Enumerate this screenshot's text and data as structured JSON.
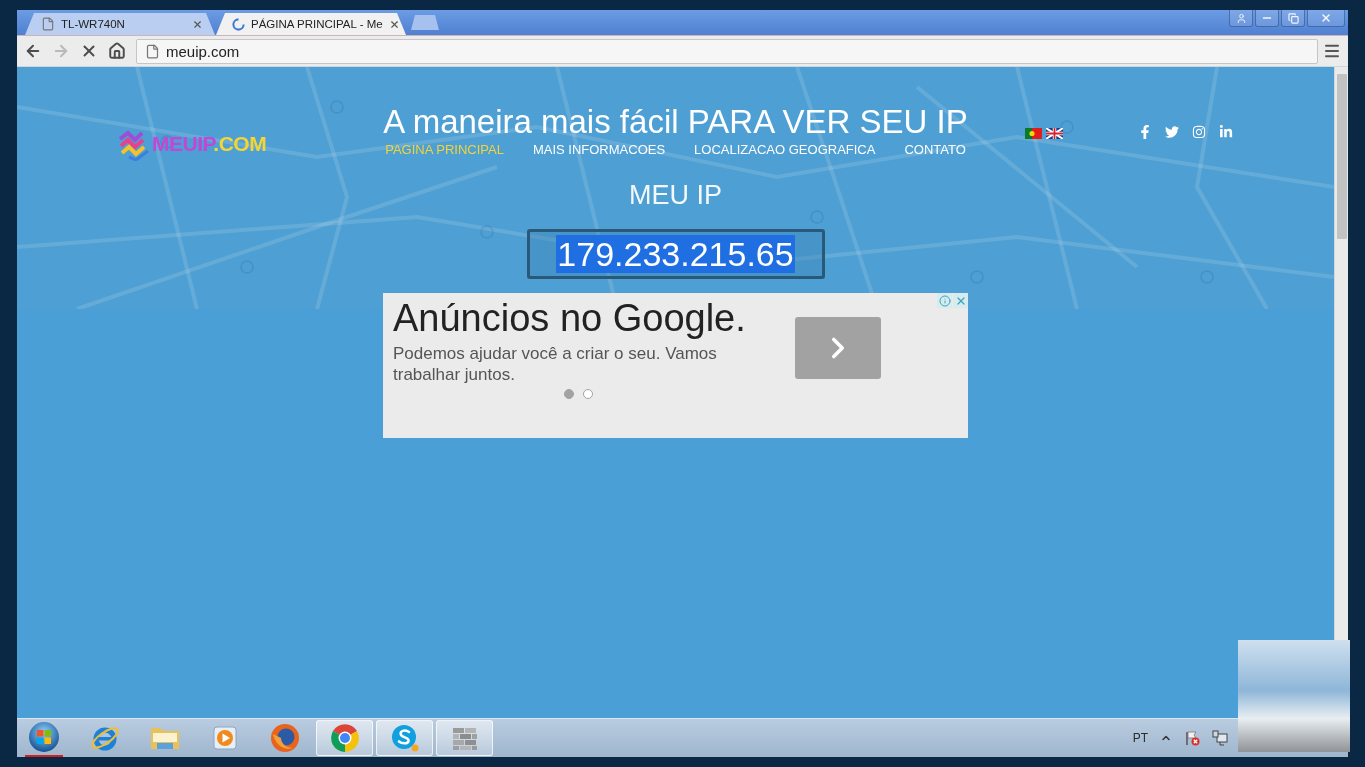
{
  "browser": {
    "tabs": [
      {
        "title": "TL-WR740N",
        "selected": false,
        "loading": false
      },
      {
        "title": "PÁGINA PRINCIPAL - Me",
        "selected": true,
        "loading": true
      }
    ],
    "nav_buttons": [
      {
        "kind": "back",
        "disabled": false
      },
      {
        "kind": "forward",
        "disabled": true
      },
      {
        "kind": "stop",
        "disabled": false
      },
      {
        "kind": "home",
        "disabled": false
      }
    ],
    "address": "meuip.com"
  },
  "site": {
    "logo": {
      "name": "MEUIP",
      "suffix": ".COM"
    },
    "headline": "A maneira mais fácil PARA VER SEU IP",
    "nav": [
      {
        "label": "PAGINA PRINCIPAL",
        "selected": true
      },
      {
        "label": "MAIS INFORMACOES",
        "selected": false
      },
      {
        "label": "LOCALIZACAO GEOGRAFICA",
        "selected": false
      },
      {
        "label": "CONTATO",
        "selected": false
      }
    ],
    "languages": [
      {
        "kind": "pt"
      },
      {
        "kind": "en"
      }
    ],
    "social": [
      {
        "kind": "facebook"
      },
      {
        "kind": "twitter"
      },
      {
        "kind": "instagram"
      },
      {
        "kind": "linkedin"
      }
    ],
    "section_title": "MEU IP",
    "ip": {
      "value": "179.233.215.65",
      "selected": true
    }
  },
  "ad": {
    "headline": "Anúncios no Google.",
    "text": "Podemos ajudar você a criar o seu. Vamos trabalhar juntos.",
    "slides": [
      {
        "selected": true
      },
      {
        "selected": false
      }
    ]
  },
  "taskbar": {
    "apps": [
      {
        "kind": "ie",
        "open": false
      },
      {
        "kind": "explorer",
        "open": false
      },
      {
        "kind": "media",
        "open": false
      },
      {
        "kind": "firefox",
        "open": false
      },
      {
        "kind": "chrome",
        "open": true
      },
      {
        "kind": "skype",
        "open": true
      },
      {
        "kind": "firewall",
        "open": true
      }
    ],
    "language": "PT"
  }
}
